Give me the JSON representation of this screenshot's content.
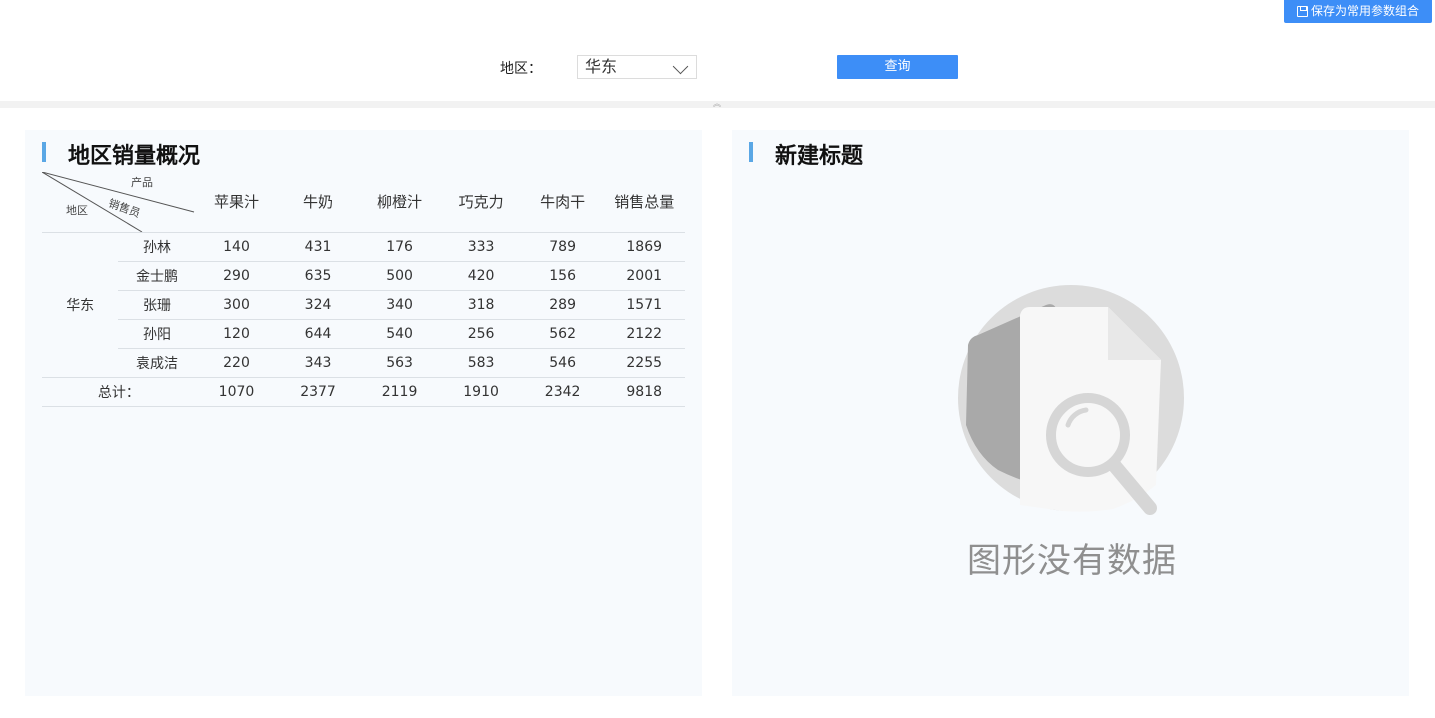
{
  "toolbar": {
    "save_label": "保存为常用参数组合",
    "region_label": "地区：",
    "region_value": "华东",
    "query_label": "查询"
  },
  "left_panel": {
    "title": "地区销量概况",
    "diag_product": "产品",
    "diag_seller": "销售员",
    "diag_region": "地区",
    "columns": [
      "苹果汁",
      "牛奶",
      "柳橙汁",
      "巧克力",
      "牛肉干",
      "销售总量"
    ],
    "region": "华东",
    "rows": [
      {
        "seller": "孙林",
        "values": [
          "140",
          "431",
          "176",
          "333",
          "789",
          "1869"
        ]
      },
      {
        "seller": "金士鹏",
        "values": [
          "290",
          "635",
          "500",
          "420",
          "156",
          "2001"
        ]
      },
      {
        "seller": "张珊",
        "values": [
          "300",
          "324",
          "340",
          "318",
          "289",
          "1571"
        ]
      },
      {
        "seller": "孙阳",
        "values": [
          "120",
          "644",
          "540",
          "256",
          "562",
          "2122"
        ]
      },
      {
        "seller": "袁成洁",
        "values": [
          "220",
          "343",
          "563",
          "583",
          "546",
          "2255"
        ]
      }
    ],
    "total_label": "总计：",
    "totals": [
      "1070",
      "2377",
      "2119",
      "1910",
      "2342",
      "9818"
    ]
  },
  "right_panel": {
    "title": "新建标题",
    "empty_text": "图形没有数据"
  },
  "colors": {
    "accent": "#3d8ef7",
    "panel_bar": "#5aa7e5",
    "panel_bg": "#f7fafd"
  }
}
